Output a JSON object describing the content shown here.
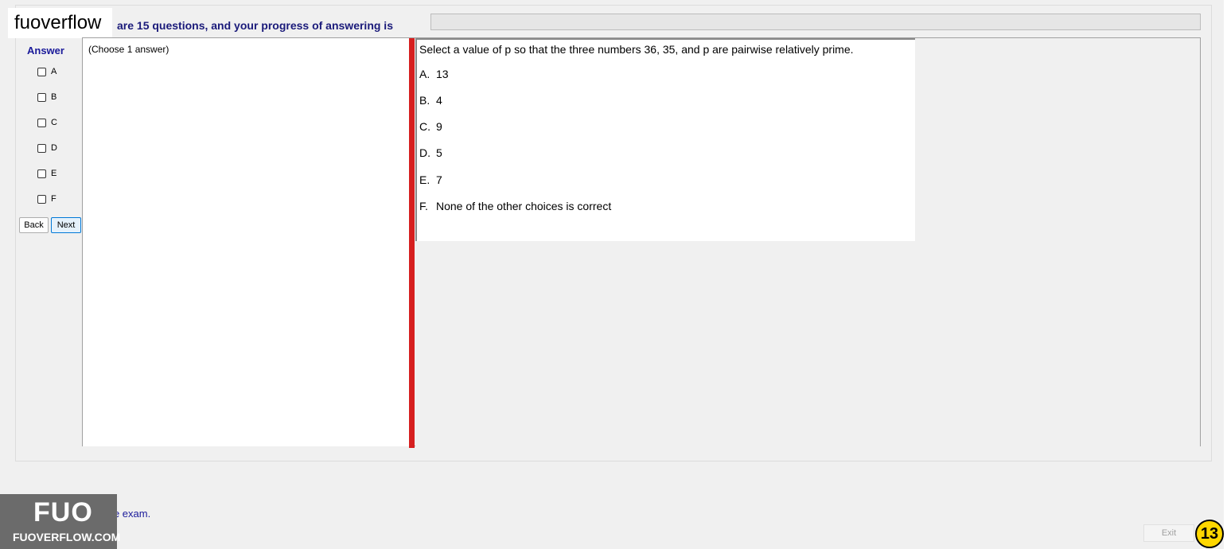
{
  "header": {
    "logo_text": "fuoverflow",
    "progress_text": "are 15 questions, and your progress of answering is",
    "progress_percent": 0
  },
  "answer_panel": {
    "title": "Answer",
    "options": [
      "A",
      "B",
      "C",
      "D",
      "E",
      "F"
    ],
    "back_label": "Back",
    "next_label": "Next"
  },
  "left_pane": {
    "choose_label": "(Choose 1 answer)"
  },
  "question": {
    "text": "Select a value of p so that the three numbers 36, 35, and p are pairwise relatively prime.",
    "choices": [
      {
        "letter": "A.",
        "text": "13"
      },
      {
        "letter": "B.",
        "text": "4"
      },
      {
        "letter": "C.",
        "text": "9"
      },
      {
        "letter": "D.",
        "text": "5"
      },
      {
        "letter": "E.",
        "text": "7"
      },
      {
        "letter": "F.",
        "text": "None of the other choices is correct"
      }
    ]
  },
  "footer": {
    "finish_label": "ant to finish the exam.",
    "exit_label": "Exit",
    "question_number": "13",
    "brand_big": "FUO",
    "brand_small": "FUOVERFLOW.COM"
  }
}
